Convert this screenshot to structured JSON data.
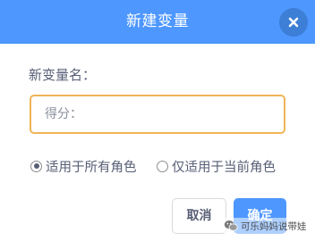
{
  "dialog": {
    "title": "新建变量",
    "name_label": "新变量名：",
    "input": {
      "value": "",
      "placeholder": "得分："
    },
    "scope_options": [
      {
        "label": "适用于所有角色",
        "selected": true
      },
      {
        "label": "仅适用于当前角色",
        "selected": false
      }
    ],
    "cancel_label": "取消",
    "ok_label": "确定",
    "close_icon": "close-icon",
    "colors": {
      "header": "#4d97ff",
      "close_button": "#3d7ed6",
      "input_border": "#f0b456",
      "ok_button": "#4d97ff",
      "text": "#575e75"
    }
  },
  "watermark": {
    "text": "可乐妈妈说带娃",
    "icon": "wechat-icon"
  }
}
